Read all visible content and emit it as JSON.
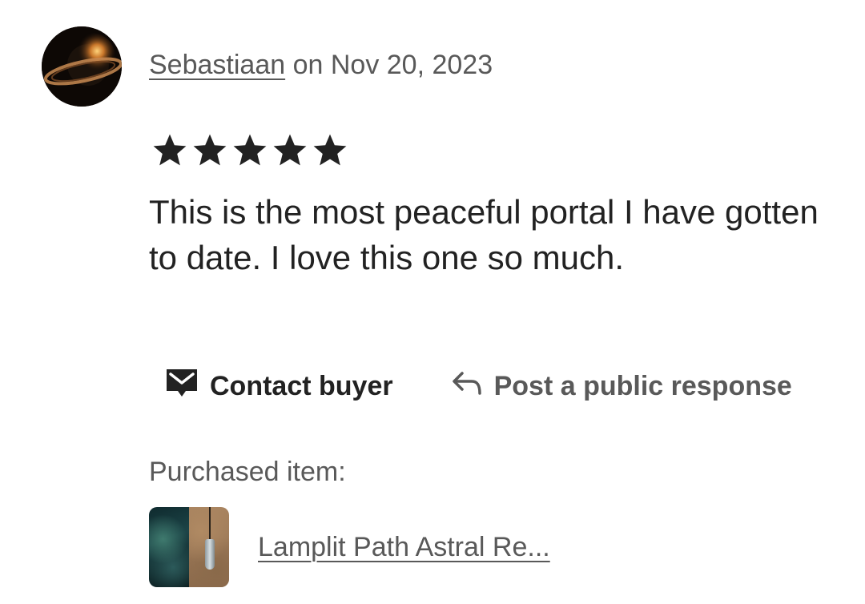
{
  "review": {
    "author": "Sebastiaan",
    "date_text": " on Nov 20, 2023",
    "rating": 5,
    "rating_max": 5,
    "text": "This is the most peaceful portal I have gotten to date. I love this one so much."
  },
  "actions": {
    "contact_label": "Contact buyer",
    "contact_icon": "envelope-icon",
    "respond_label": "Post a public response",
    "respond_icon": "reply-arrow-icon"
  },
  "purchase": {
    "label": "Purchased item:",
    "item_title": "Lamplit Path Astral Re..."
  },
  "colors": {
    "text_primary": "#222222",
    "text_secondary": "#595959",
    "star": "#222222",
    "background": "#ffffff"
  }
}
